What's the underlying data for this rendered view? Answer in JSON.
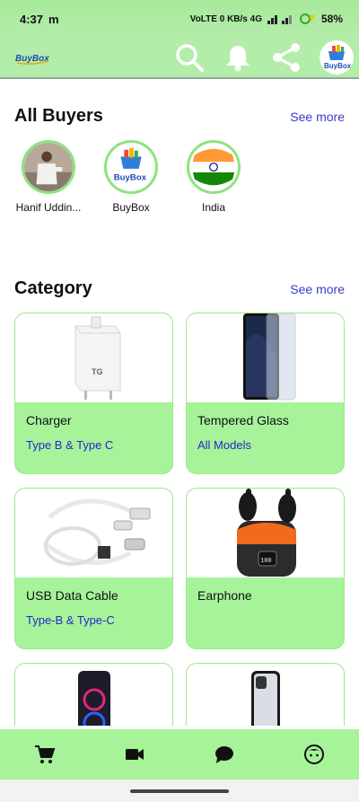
{
  "status_bar": {
    "time": "4:37",
    "app_indicator": "m",
    "network_labels": "VoLTE  0 KB/s  4G",
    "battery": "58%"
  },
  "app_bar": {
    "logo_text": "BuyBox",
    "icons": [
      "search-icon",
      "bell-icon",
      "share-icon"
    ],
    "profile_logo_text": "BuyBox"
  },
  "buyers_section": {
    "title": "All Buyers",
    "see_more": "See more",
    "items": [
      {
        "name": "Hanif Uddin...",
        "icon": "person-photo"
      },
      {
        "name": "BuyBox",
        "icon": "buybox-logo"
      },
      {
        "name": "India",
        "icon": "india-flag"
      }
    ]
  },
  "category_section": {
    "title": "Category",
    "see_more": "See more",
    "items": [
      {
        "name": "Charger",
        "subtitle": "Type B & Type C",
        "icon": "charger"
      },
      {
        "name": "Tempered Glass",
        "subtitle": "All Models",
        "icon": "phone-glass"
      },
      {
        "name": "USB Data Cable",
        "subtitle": "Type-B & Type-C",
        "icon": "usb-cable"
      },
      {
        "name": "Earphone",
        "subtitle": "",
        "icon": "earbuds"
      },
      {
        "name": "",
        "subtitle": "",
        "icon": "speaker"
      },
      {
        "name": "",
        "subtitle": "",
        "icon": "phone-case"
      }
    ]
  },
  "bottom_nav": {
    "items": [
      "cart-icon",
      "video-icon",
      "chat-icon",
      "profile-icon"
    ]
  },
  "colors": {
    "accent_green": "#a6f39a",
    "link_blue": "#3a3ad0",
    "subtitle_blue": "#2727c9"
  }
}
